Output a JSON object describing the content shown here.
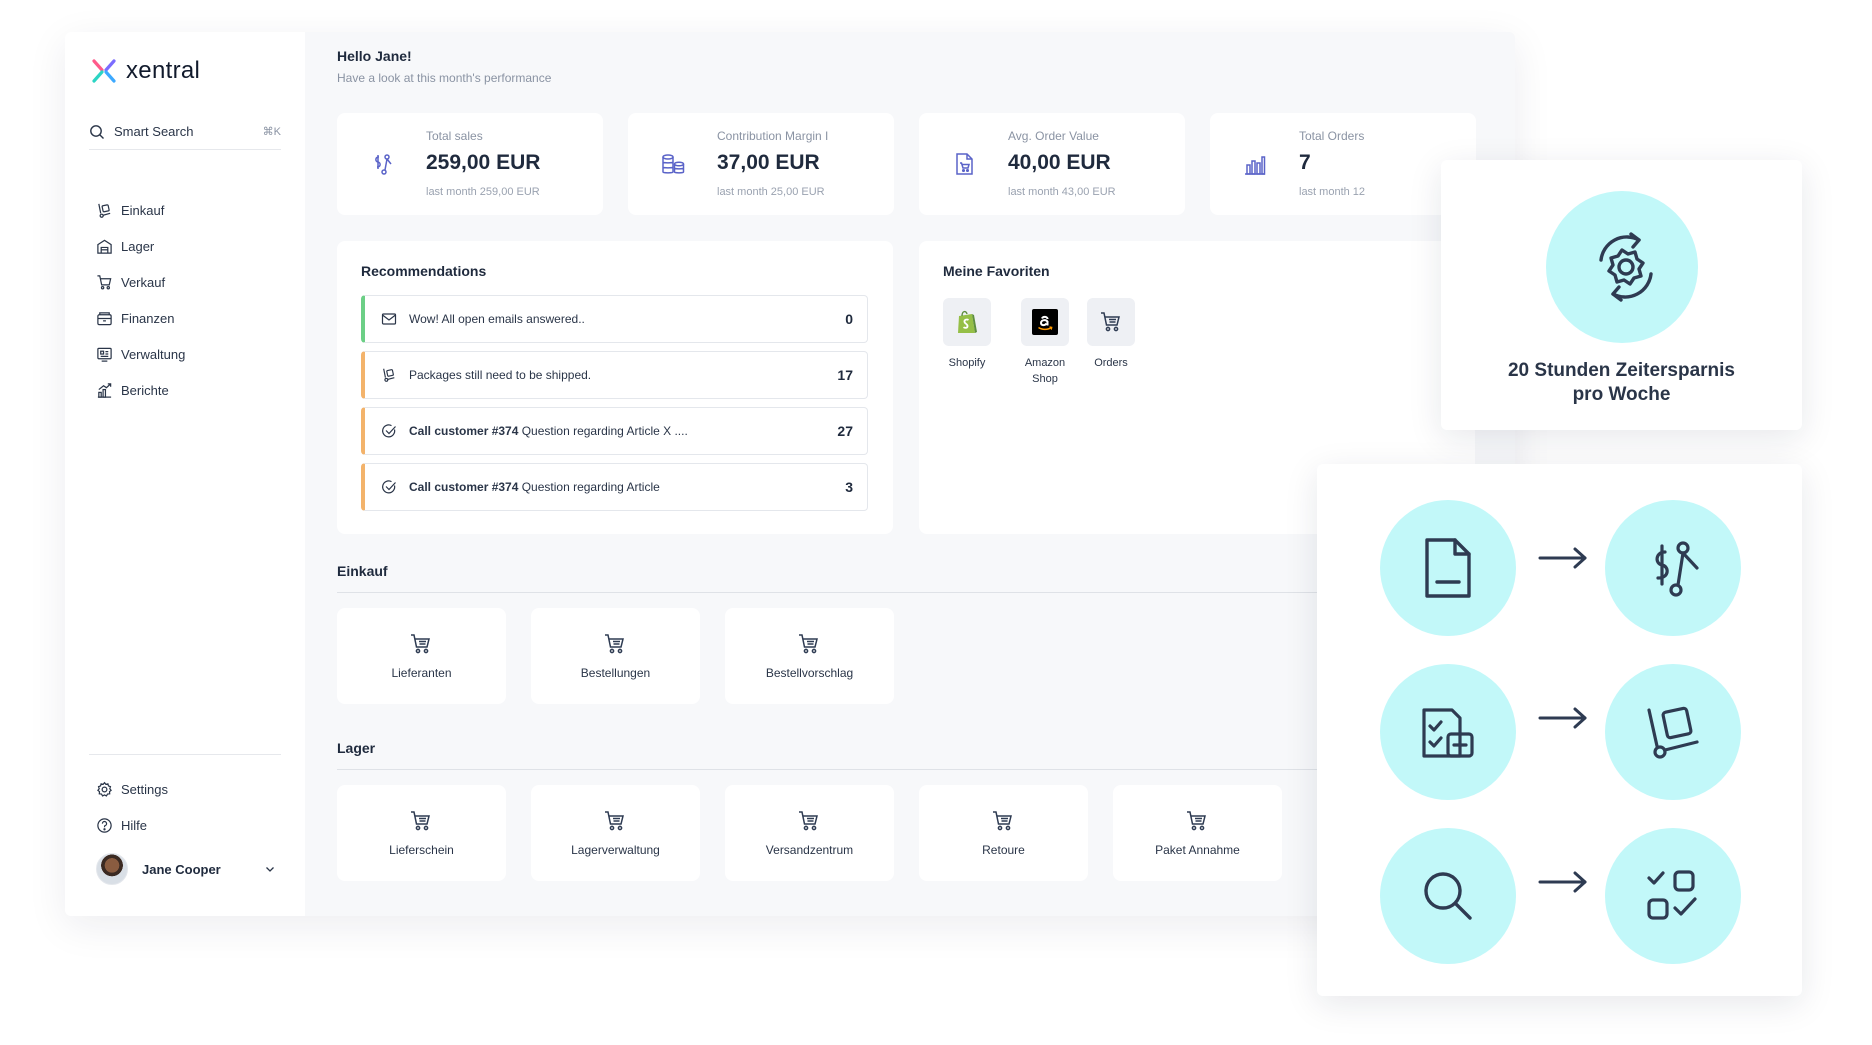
{
  "brand": {
    "name": "xentral"
  },
  "sidebar": {
    "search": {
      "label": "Smart Search",
      "shortcut": "⌘K"
    },
    "items": [
      {
        "label": "Einkauf",
        "icon": "dolly-icon"
      },
      {
        "label": "Lager",
        "icon": "warehouse-icon"
      },
      {
        "label": "Verkauf",
        "icon": "cart-icon"
      },
      {
        "label": "Finanzen",
        "icon": "wallet-icon"
      },
      {
        "label": "Verwaltung",
        "icon": "admin-icon"
      },
      {
        "label": "Berichte",
        "icon": "report-icon"
      }
    ],
    "bottom": [
      {
        "label": "Settings",
        "icon": "gear-icon"
      },
      {
        "label": "Hilfe",
        "icon": "help-icon"
      }
    ],
    "user": {
      "name": "Jane Cooper"
    }
  },
  "header": {
    "greeting": "Hello Jane!",
    "subtitle": "Have a look at this month's performance"
  },
  "stats": [
    {
      "label": "Total sales",
      "value": "259,00 EUR",
      "sub": "last month 259,00 EUR"
    },
    {
      "label": "Contribution Margin I",
      "value": "37,00 EUR",
      "sub": "last month 25,00 EUR"
    },
    {
      "label": "Avg. Order Value",
      "value": "40,00 EUR",
      "sub": "last month 43,00 EUR"
    },
    {
      "label": "Total Orders",
      "value": "7",
      "sub": "last month 12"
    }
  ],
  "recommendations": {
    "title": "Recommendations",
    "items": [
      {
        "bold": "",
        "text": "Wow! All open emails answered..",
        "count": "0",
        "status": "green"
      },
      {
        "bold": "",
        "text": "Packages still need to be shipped.",
        "count": "17",
        "status": "orange"
      },
      {
        "bold": "Call customer #374",
        "text": " Question regarding Article X ....",
        "count": "27",
        "status": "orange"
      },
      {
        "bold": "Call customer #374",
        "text": " Question regarding Article",
        "count": "3",
        "status": "orange"
      }
    ]
  },
  "favorites": {
    "title": "Meine Favoriten",
    "items": [
      {
        "label": "Shopify"
      },
      {
        "label": "Amazon Shop"
      },
      {
        "label": "Orders"
      }
    ]
  },
  "sections": {
    "einkauf": {
      "title": "Einkauf",
      "tiles": [
        "Lieferanten",
        "Bestellungen",
        "Bestellvorschlag"
      ]
    },
    "lager": {
      "title": "Lager",
      "tiles": [
        "Lieferschein",
        "Lagerverwaltung",
        "Versandzentrum",
        "Retoure",
        "Paket Annahme"
      ]
    }
  },
  "promo": {
    "line1": "20 Stunden Zeitersparnis",
    "line2": "pro Woche"
  },
  "colors": {
    "accent": "#c2f8f9",
    "icon_stroke": "#2e3b52",
    "stat_icon": "#5a63c8",
    "green": "#6ccf86",
    "orange": "#f3b36b"
  }
}
